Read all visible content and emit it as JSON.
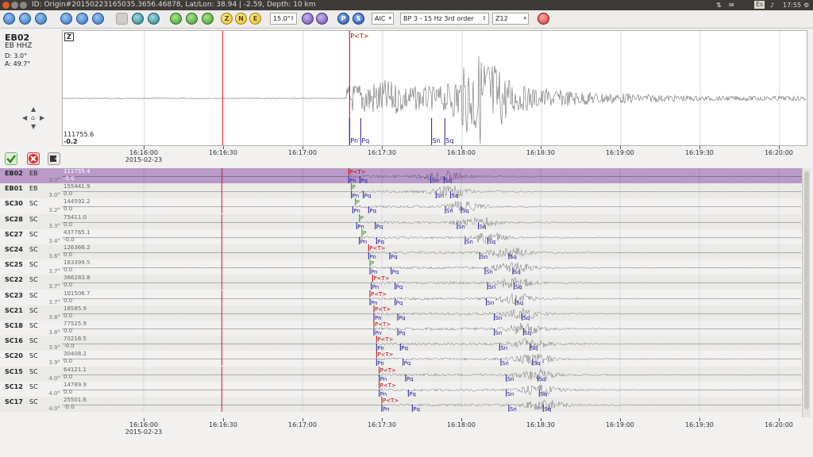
{
  "window": {
    "title": "ID: Origin#20150223165035.3656.46878, Lat/Lon: 38.94 | -2.59, Depth: 10 km",
    "tray_lang": "Es",
    "tray_time": "17:55"
  },
  "toolbar": {
    "filter_value": "15.0\"",
    "picker_mode": "AIC",
    "filter_label": "BP 3 - 15 Hz 3rd order",
    "component_option": "Z12",
    "btn_z": "Z",
    "btn_n": "N",
    "btn_e": "E",
    "btn_p": "P",
    "btn_s": "S"
  },
  "current_station": {
    "code": "EB02",
    "channel": "EB  HHZ",
    "distance": "D:  3.0°",
    "azimuth": "A:  49.7°",
    "component": "Z",
    "amp_max": "111755.6",
    "amp_min": "-0.2",
    "picks": [
      {
        "label": "P<T>",
        "t": 47.5,
        "color": "#c00000",
        "pos": "top"
      },
      {
        "label": "Pn",
        "t": 47.5,
        "color": "#1a1aa0",
        "pos": "bottom"
      },
      {
        "label": "Pq",
        "t": 51.7,
        "color": "#1a1aa0",
        "pos": "bottom"
      },
      {
        "label": "Sn",
        "t": 78.5,
        "color": "#1a1aa0",
        "pos": "bottom"
      },
      {
        "label": "Sq",
        "t": 83.5,
        "color": "#1a1aa0",
        "pos": "bottom"
      }
    ]
  },
  "time_axis": {
    "date": "2015-02-23",
    "ticks": [
      "16:16:00",
      "16:16:30",
      "16:17:00",
      "16:17:30",
      "16:18:00",
      "16:18:30",
      "16:19:00",
      "16:19:30",
      "16:20:00"
    ]
  },
  "traces": [
    {
      "code": "EB02",
      "net": "EB",
      "dist": "3.0°",
      "amp": "111755.4",
      "amp_min": "-0.0",
      "selected": true,
      "picks": [
        {
          "label": "P<T>",
          "t": 47.5,
          "c": "#c00000",
          "pos": "top"
        },
        {
          "label": "Pn",
          "t": 47.5,
          "c": "#1a1aa0",
          "pos": "bottom"
        },
        {
          "label": "Pq",
          "t": 51.7,
          "c": "#1a1aa0",
          "pos": "bottom"
        },
        {
          "label": "Sn",
          "t": 78.5,
          "c": "#1a1aa0",
          "pos": "bottom"
        },
        {
          "label": "Sq",
          "t": 83.5,
          "c": "#1a1aa0",
          "pos": "bottom"
        }
      ]
    },
    {
      "code": "EB01",
      "net": "EB",
      "dist": "3.0°",
      "amp": "155441.9",
      "amp_min": "0.0",
      "picks": [
        {
          "label": "P",
          "t": 48.5,
          "c": "#1a8a1a",
          "pos": "top"
        },
        {
          "label": "Pn",
          "t": 48.5,
          "c": "#1a1aa0",
          "pos": "bottom"
        },
        {
          "label": "Pq",
          "t": 53,
          "c": "#1a1aa0",
          "pos": "bottom"
        },
        {
          "label": "Sn",
          "t": 80.5,
          "c": "#1a1aa0",
          "pos": "bottom"
        },
        {
          "label": "Sq",
          "t": 86,
          "c": "#1a1aa0",
          "pos": "bottom"
        }
      ]
    },
    {
      "code": "SC30",
      "net": "SC",
      "dist": "3.2°",
      "amp": "144592.2",
      "amp_min": "0.0",
      "picks": [
        {
          "label": "P",
          "t": 50,
          "c": "#1a8a1a",
          "pos": "top"
        },
        {
          "label": "Pn",
          "t": 49,
          "c": "#1a1aa0",
          "pos": "bottom"
        },
        {
          "label": "Pq",
          "t": 55,
          "c": "#1a1aa0",
          "pos": "bottom"
        },
        {
          "label": "Sn",
          "t": 84,
          "c": "#1a1aa0",
          "pos": "bottom"
        },
        {
          "label": "Sq",
          "t": 90,
          "c": "#1a1aa0",
          "pos": "bottom"
        }
      ]
    },
    {
      "code": "SC28",
      "net": "SC",
      "dist": "3.3°",
      "amp": "75411.0",
      "amp_min": "0.0",
      "picks": [
        {
          "label": "P",
          "t": 51.5,
          "c": "#1a8a1a",
          "pos": "top"
        },
        {
          "label": "Pn",
          "t": 50.5,
          "c": "#1a1aa0",
          "pos": "bottom"
        },
        {
          "label": "Pq",
          "t": 57.5,
          "c": "#1a1aa0",
          "pos": "bottom"
        },
        {
          "label": "Sn",
          "t": 88.5,
          "c": "#1a1aa0",
          "pos": "bottom"
        },
        {
          "label": "Sq",
          "t": 96.5,
          "c": "#1a1aa0",
          "pos": "bottom"
        }
      ]
    },
    {
      "code": "SC27",
      "net": "SC",
      "dist": "3.4°",
      "amp": "437765.1",
      "amp_min": "-0.0",
      "picks": [
        {
          "label": "P",
          "t": 52.5,
          "c": "#1a8a1a",
          "pos": "top"
        },
        {
          "label": "Pn",
          "t": 51.5,
          "c": "#1a1aa0",
          "pos": "bottom"
        },
        {
          "label": "Pq",
          "t": 58,
          "c": "#1a1aa0",
          "pos": "bottom"
        },
        {
          "label": "Sn",
          "t": 91.5,
          "c": "#1a1aa0",
          "pos": "bottom"
        },
        {
          "label": "Sq",
          "t": 100,
          "c": "#1a1aa0",
          "pos": "bottom"
        }
      ]
    },
    {
      "code": "SC24",
      "net": "SC",
      "dist": "3.6°",
      "amp": "126366.2",
      "amp_min": "0.0",
      "picks": [
        {
          "label": "P<T>",
          "t": 55,
          "c": "#c00000",
          "pos": "top"
        },
        {
          "label": "Pn",
          "t": 55,
          "c": "#1a1aa0",
          "pos": "bottom"
        },
        {
          "label": "Pq",
          "t": 63,
          "c": "#1a1aa0",
          "pos": "bottom"
        },
        {
          "label": "Sn",
          "t": 97,
          "c": "#1a1aa0",
          "pos": "bottom"
        },
        {
          "label": "Sq",
          "t": 108,
          "c": "#1a1aa0",
          "pos": "bottom"
        }
      ]
    },
    {
      "code": "SC25",
      "net": "SC",
      "dist": "3.7°",
      "amp": "183399.5",
      "amp_min": "0.0",
      "picks": [
        {
          "label": "P",
          "t": 55.5,
          "c": "#1a8a1a",
          "pos": "top"
        },
        {
          "label": "Pn",
          "t": 55.5,
          "c": "#1a1aa0",
          "pos": "bottom"
        },
        {
          "label": "Pq",
          "t": 63.5,
          "c": "#1a1aa0",
          "pos": "bottom"
        },
        {
          "label": "Sn",
          "t": 99,
          "c": "#1a1aa0",
          "pos": "bottom"
        },
        {
          "label": "Sq",
          "t": 109.5,
          "c": "#1a1aa0",
          "pos": "bottom"
        }
      ]
    },
    {
      "code": "SC22",
      "net": "SC",
      "dist": "3.7°",
      "amp": "366283.8",
      "amp_min": "0.0",
      "picks": [
        {
          "label": "P<T>",
          "t": 56.5,
          "c": "#c00000",
          "pos": "top"
        },
        {
          "label": "Pn",
          "t": 56,
          "c": "#1a1aa0",
          "pos": "bottom"
        },
        {
          "label": "Pq",
          "t": 65,
          "c": "#1a1aa0",
          "pos": "bottom"
        },
        {
          "label": "Sn",
          "t": 100,
          "c": "#1a1aa0",
          "pos": "bottom"
        },
        {
          "label": "Sq",
          "t": 110,
          "c": "#1a1aa0",
          "pos": "bottom"
        }
      ]
    },
    {
      "code": "SC23",
      "net": "SC",
      "dist": "3.7°",
      "amp": "101506.7",
      "amp_min": "0.0",
      "picks": [
        {
          "label": "P<T>",
          "t": 55.5,
          "c": "#c00000",
          "pos": "top"
        },
        {
          "label": "Pn",
          "t": 55.5,
          "c": "#1a1aa0",
          "pos": "bottom"
        },
        {
          "label": "Pq",
          "t": 65,
          "c": "#1a1aa0",
          "pos": "bottom"
        },
        {
          "label": "Sn",
          "t": 99.5,
          "c": "#1a1aa0",
          "pos": "bottom"
        },
        {
          "label": "Sq",
          "t": 110.5,
          "c": "#1a1aa0",
          "pos": "bottom"
        }
      ]
    },
    {
      "code": "SC21",
      "net": "SC",
      "dist": "3.8°",
      "amp": "18585.9",
      "amp_min": "0.0",
      "picks": [
        {
          "label": "P<T>",
          "t": 57,
          "c": "#c00000",
          "pos": "top"
        },
        {
          "label": "Pn",
          "t": 57,
          "c": "#1a1aa0",
          "pos": "bottom"
        },
        {
          "label": "Pq",
          "t": 66,
          "c": "#1a1aa0",
          "pos": "bottom"
        },
        {
          "label": "Sn",
          "t": 102.5,
          "c": "#1a1aa0",
          "pos": "bottom"
        },
        {
          "label": "Sq",
          "t": 113,
          "c": "#1a1aa0",
          "pos": "bottom"
        }
      ]
    },
    {
      "code": "SC18",
      "net": "SC",
      "dist": "3.8°",
      "amp": "77525.9",
      "amp_min": "0.0",
      "picks": [
        {
          "label": "P<T>",
          "t": 57,
          "c": "#c00000",
          "pos": "top"
        },
        {
          "label": "Pn",
          "t": 57,
          "c": "#1a1aa0",
          "pos": "bottom"
        },
        {
          "label": "Pq",
          "t": 66,
          "c": "#1a1aa0",
          "pos": "bottom"
        },
        {
          "label": "Sn",
          "t": 102.5,
          "c": "#1a1aa0",
          "pos": "bottom"
        },
        {
          "label": "Sq",
          "t": 113.5,
          "c": "#1a1aa0",
          "pos": "bottom"
        }
      ]
    },
    {
      "code": "SC16",
      "net": "SC",
      "dist": "3.9°",
      "amp": "70216.5",
      "amp_min": "-0.0",
      "picks": [
        {
          "label": "P<T>",
          "t": 58,
          "c": "#c00000",
          "pos": "top"
        },
        {
          "label": "Pn",
          "t": 58,
          "c": "#1a1aa0",
          "pos": "bottom"
        },
        {
          "label": "Pq",
          "t": 67,
          "c": "#1a1aa0",
          "pos": "bottom"
        },
        {
          "label": "Sn",
          "t": 104.5,
          "c": "#1a1aa0",
          "pos": "bottom"
        },
        {
          "label": "Sq",
          "t": 116,
          "c": "#1a1aa0",
          "pos": "bottom"
        }
      ]
    },
    {
      "code": "SC20",
      "net": "SC",
      "dist": "3.9°",
      "amp": "30408.2",
      "amp_min": "0.0",
      "picks": [
        {
          "label": "P<T>",
          "t": 58,
          "c": "#c00000",
          "pos": "top"
        },
        {
          "label": "Pn",
          "t": 58,
          "c": "#1a1aa0",
          "pos": "bottom"
        },
        {
          "label": "Pq",
          "t": 68,
          "c": "#1a1aa0",
          "pos": "bottom"
        },
        {
          "label": "Sn",
          "t": 105,
          "c": "#1a1aa0",
          "pos": "bottom"
        },
        {
          "label": "Sq",
          "t": 117,
          "c": "#1a1aa0",
          "pos": "bottom"
        }
      ]
    },
    {
      "code": "SC15",
      "net": "SC",
      "dist": "4.0°",
      "amp": "64121.1",
      "amp_min": "0.0",
      "picks": [
        {
          "label": "P<T>",
          "t": 59,
          "c": "#c00000",
          "pos": "top"
        },
        {
          "label": "Pn",
          "t": 59,
          "c": "#1a1aa0",
          "pos": "bottom"
        },
        {
          "label": "Pq",
          "t": 69,
          "c": "#1a1aa0",
          "pos": "bottom"
        },
        {
          "label": "Sn",
          "t": 107,
          "c": "#1a1aa0",
          "pos": "bottom"
        },
        {
          "label": "Sq",
          "t": 119,
          "c": "#1a1aa0",
          "pos": "bottom"
        }
      ]
    },
    {
      "code": "SC12",
      "net": "SC",
      "dist": "4.0°",
      "amp": "14789.9",
      "amp_min": "0.0",
      "picks": [
        {
          "label": "P<T>",
          "t": 59,
          "c": "#c00000",
          "pos": "top"
        },
        {
          "label": "Pn",
          "t": 59,
          "c": "#1a1aa0",
          "pos": "bottom"
        },
        {
          "label": "Pq",
          "t": 70,
          "c": "#1a1aa0",
          "pos": "bottom"
        },
        {
          "label": "Sn",
          "t": 107,
          "c": "#1a1aa0",
          "pos": "bottom"
        },
        {
          "label": "Sq",
          "t": 119.5,
          "c": "#1a1aa0",
          "pos": "bottom"
        }
      ]
    },
    {
      "code": "SC17",
      "net": "SC",
      "dist": "4.0°",
      "amp": "25501.6",
      "amp_min": "-0.0",
      "picks": [
        {
          "label": "P<T>",
          "t": 60,
          "c": "#c00000",
          "pos": "top"
        },
        {
          "label": "Pn",
          "t": 60,
          "c": "#1a1aa0",
          "pos": "bottom"
        },
        {
          "label": "Pq",
          "t": 71.5,
          "c": "#1a1aa0",
          "pos": "bottom"
        },
        {
          "label": "Sn",
          "t": 108,
          "c": "#1a1aa0",
          "pos": "bottom"
        },
        {
          "label": "Sq",
          "t": 121,
          "c": "#1a1aa0",
          "pos": "bottom"
        }
      ]
    }
  ],
  "colors": {
    "selected_row": "#b99ac8",
    "reference_line": "#e02020",
    "waveform": "#6e6e6e"
  }
}
